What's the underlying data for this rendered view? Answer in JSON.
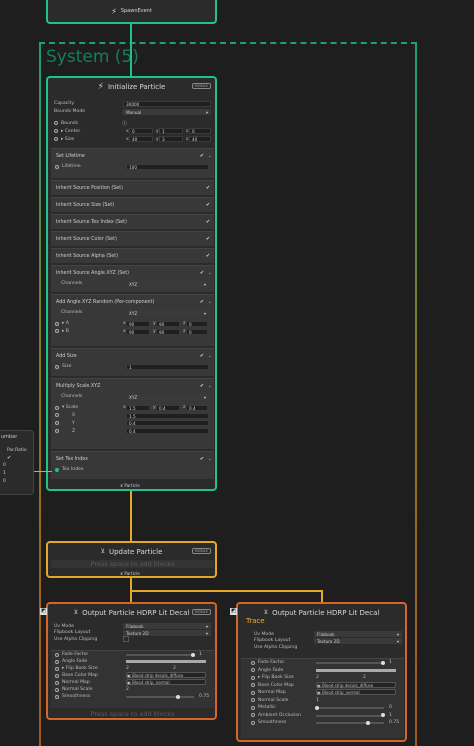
{
  "spawn": {
    "label": "SpawnEvent"
  },
  "system": {
    "title": "System (5)"
  },
  "init": {
    "title": "Initialize Particle",
    "badge": "MOBILE",
    "capacity_label": "Capacity",
    "capacity_value": "30000",
    "bounds_mode_label": "Bounds Mode",
    "bounds_mode_value": "Manual",
    "bounds_label": "Bounds",
    "center_label": "▸ Center",
    "size_label": "▸ Size",
    "center": [
      "0",
      "1",
      "0"
    ],
    "size": [
      "40",
      "3",
      "40"
    ],
    "axes": [
      "x",
      "y",
      "z"
    ],
    "set_lifetime": "Set Lifetime",
    "lifetime_label": "Lifetime",
    "lifetime_value": "100",
    "inherit": [
      "Inherit Source Position (Set)",
      "Inherit Source Size (Set)",
      "Inherit Source Tex Index (Set)",
      "Inherit Source Color (Set)",
      "Inherit Source Alpha (Set)",
      "Inherit Source Angle.XYZ (Set)"
    ],
    "channels_label": "Channels",
    "channels_value": "XYZ",
    "add_angle": "Add Angle.XYZ Random (Per-component)",
    "angle_a_label": "▸ A",
    "angle_b_label": "▸ B",
    "angle_a": [
      "90",
      "90",
      "0"
    ],
    "angle_b": [
      "90",
      "90",
      "0"
    ],
    "add_size": "Add Size",
    "size_label2": "Size",
    "size_value": "1",
    "multiply_scale": "Multiply Scale.XYZ",
    "scale_label": "▾ Scale",
    "scale": [
      "1.5",
      "0.4",
      "0.4"
    ],
    "scale_x_label": "X",
    "scale_x": "1.5",
    "scale_y_label": "Y",
    "scale_y": "0.4",
    "scale_z_label": "Z",
    "scale_z": "0.4",
    "set_tex_index": "Set Tex Index",
    "tex_index_label": "Tex Index",
    "output_flow": "Particle"
  },
  "side": {
    "title": "umber",
    "prop": "Par.Ratio",
    "rows": [
      "",
      "0",
      "1",
      "0"
    ]
  },
  "update": {
    "title": "Update Particle",
    "badge": "MOBILE",
    "placeholder": "Press space to add blocks",
    "output_flow": "Particle"
  },
  "out1": {
    "title": "Output Particle HDRP Lit Decal",
    "badge": "MOBILE",
    "uv_mode_label": "Uv Mode",
    "uv_mode": "Flipbook",
    "flipbook_layout_label": "Flipbook Layout",
    "flipbook_layout": "Texture 2D",
    "alpha_clip_label": "Use Alpha Clipping",
    "fade_factor_label": "Fade Factor",
    "fade_factor": "1",
    "angle_fade_label": "Angle Fade",
    "flip_book_size_label": "▸ Flip Book Size",
    "flip_book_size": [
      "2",
      "2"
    ],
    "base_color_map_label": "Base Color Map",
    "base_color_map": "Blood strip decals_diffuse",
    "normal_map_label": "Normal Map",
    "normal_map": "Blood strip_normal",
    "normal_scale_label": "Normal Scale",
    "normal_scale": "2",
    "smoothness_label": "Smoothness",
    "smoothness": "0.75",
    "placeholder": "Press space to add blocks"
  },
  "out2": {
    "title": "Output Particle HDRP Lit Decal",
    "badge": "MOBILE",
    "trace": "Trace",
    "uv_mode_label": "Uv Mode",
    "uv_mode": "Flipbook",
    "flipbook_layout_label": "Flipbook Layout",
    "flipbook_layout": "Texture 2D",
    "alpha_clip_label": "Use Alpha Clipping",
    "fade_factor_label": "Fade Factor",
    "fade_factor": "1",
    "angle_fade_label": "Angle Fade",
    "flip_book_size_label": "▸ Flip Book Size",
    "flip_book_size": [
      "2",
      "2"
    ],
    "base_color_map_label": "Base Color Map",
    "base_color_map": "Blood strip decals_diffuse",
    "normal_map_label": "Normal Map",
    "normal_map": "Blood strip_normal",
    "normal_scale_label": "Normal Scale",
    "normal_scale": "1",
    "metallic_label": "Metallic",
    "metallic": "0",
    "ao_label": "Ambient Occlusion",
    "ao": "1",
    "smoothness_label": "Smoothness",
    "smoothness": "0.75"
  },
  "colors": {
    "system_green": "#1ec28b",
    "flow_yellow": "#e3a82a",
    "output_orange": "#d5652a"
  }
}
